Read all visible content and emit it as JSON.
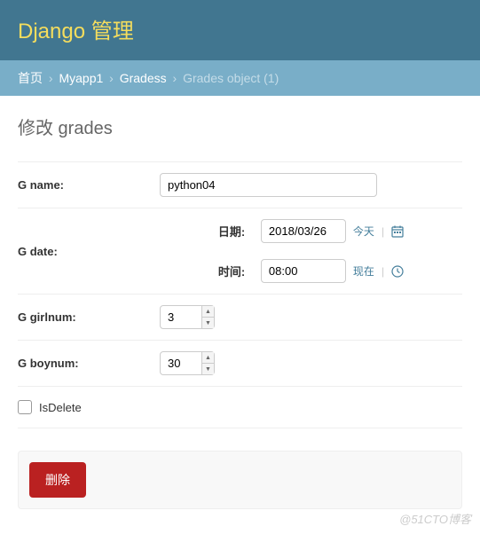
{
  "header": {
    "title": "Django 管理"
  },
  "breadcrumbs": {
    "home": "首页",
    "app": "Myapp1",
    "model": "Gradess",
    "current": "Grades object (1)"
  },
  "page": {
    "title": "修改 grades"
  },
  "fields": {
    "gname": {
      "label": "G name:",
      "value": "python04"
    },
    "gdate": {
      "label": "G date:",
      "date_label": "日期:",
      "date_value": "2018/03/26",
      "today_link": "今天",
      "time_label": "时间:",
      "time_value": "08:00",
      "now_link": "现在"
    },
    "ggirlnum": {
      "label": "G girlnum:",
      "value": "3"
    },
    "gboynum": {
      "label": "G boynum:",
      "value": "30"
    },
    "isdelete": {
      "label": "IsDelete",
      "checked": false
    }
  },
  "actions": {
    "delete": "删除"
  },
  "watermark": "@51CTO博客"
}
